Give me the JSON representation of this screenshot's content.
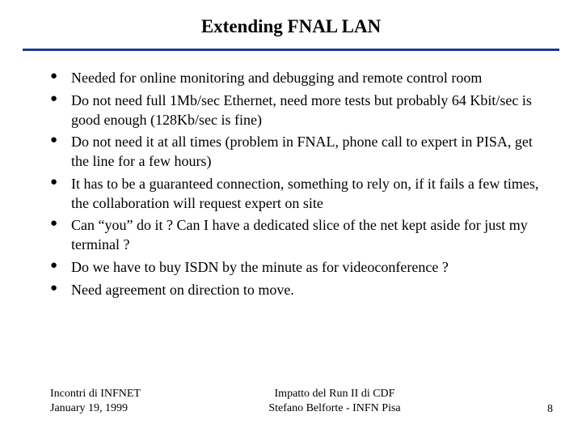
{
  "title": "Extending FNAL LAN",
  "bullets": [
    "Needed for online monitoring and debugging and remote control room",
    "Do not need full 1Mb/sec Ethernet, need more tests but probably 64 Kbit/sec is good enough (128Kb/sec is fine)",
    "Do not need it at all times (problem in FNAL, phone call to expert in PISA, get the line for a few hours)",
    "It has to be a guaranteed connection, something to rely on, if it fails a few times, the collaboration will request expert on site",
    "Can “you” do it ? Can I have a dedicated slice of the net kept aside for just my terminal ?",
    "Do we have to buy ISDN by the minute as for videoconference ?",
    "Need agreement on direction to move."
  ],
  "footer": {
    "left_line1": "Incontri di INFNET",
    "left_line2": "January 19, 1999",
    "center_line1": "Impatto del Run II di CDF",
    "center_line2": "Stefano Belforte - INFN Pisa",
    "page": "8"
  }
}
